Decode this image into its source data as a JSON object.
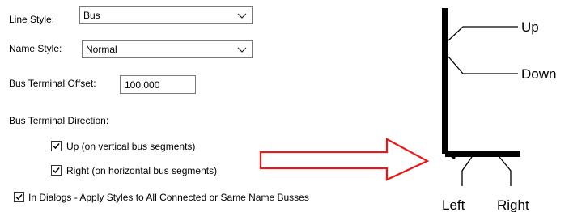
{
  "line_style": {
    "label": "Line Style:",
    "value": "Bus"
  },
  "name_style": {
    "label": "Name Style:",
    "value": "Normal"
  },
  "bus_terminal_offset": {
    "label": "Bus Terminal Offset:",
    "value": "100.000"
  },
  "bus_terminal_direction": {
    "heading": "Bus Terminal Direction:",
    "options": [
      {
        "label": "Up  (on vertical bus segments)",
        "checked": true
      },
      {
        "label": "Right  (on horizontal bus segments)",
        "checked": true
      }
    ]
  },
  "apply_styles": {
    "label": "In Dialogs - Apply Styles to All Connected or Same Name Busses",
    "checked": true
  },
  "diagram": {
    "labels": {
      "up": "Up",
      "down": "Down",
      "left": "Left",
      "right": "Right"
    },
    "arrow_color": "#e81818"
  }
}
